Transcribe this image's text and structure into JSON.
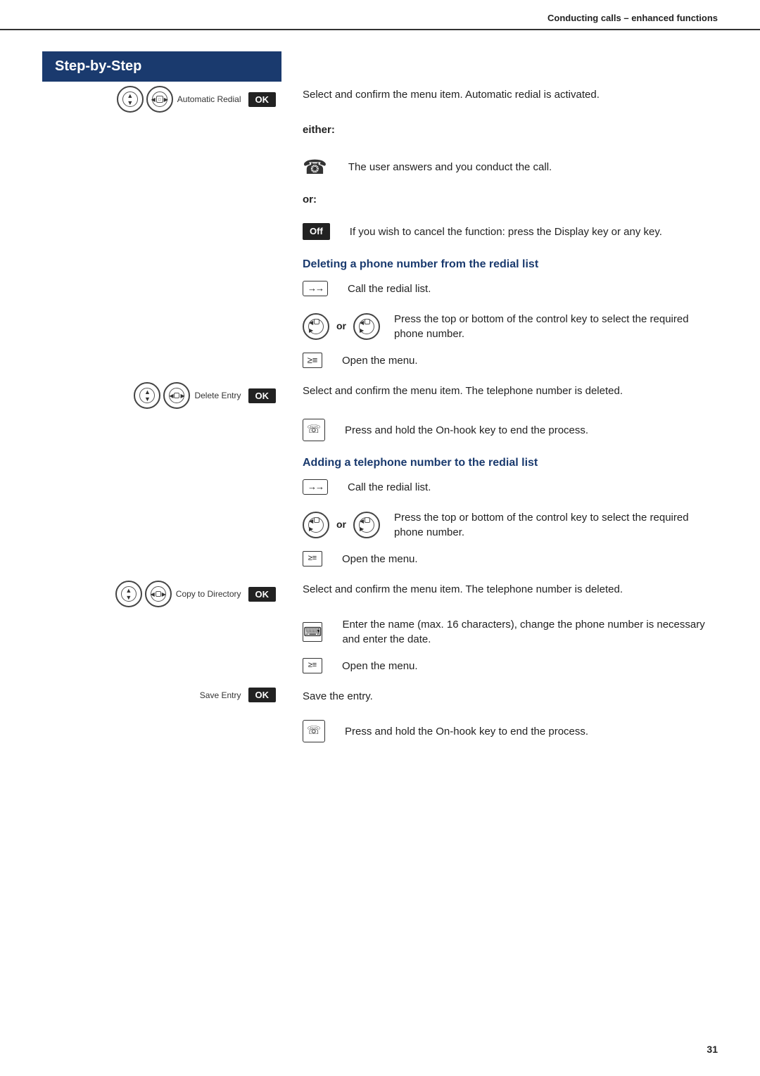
{
  "header": {
    "title": "Conducting calls – enhanced functions"
  },
  "step_by_step": "Step-by-Step",
  "rows": [
    {
      "id": "row-auto-redial",
      "left_label": "Automatic Redial",
      "left_type": "ctrl-pair-ok",
      "right_text": "Select and confirm the menu item. Automatic redial is activated."
    },
    {
      "id": "row-either",
      "left_type": "either-label",
      "left_text": "either:"
    },
    {
      "id": "row-phone",
      "left_type": "phone",
      "right_text": "The user answers and you conduct the call."
    },
    {
      "id": "row-or1",
      "left_type": "or-label",
      "left_text": "or:"
    },
    {
      "id": "row-off",
      "left_type": "off-btn",
      "right_text": "If you wish to cancel the function: press the Display key or any key."
    },
    {
      "id": "row-section1",
      "type": "section",
      "text": "Deleting a phone number from the redial list"
    },
    {
      "id": "row-arrow1",
      "left_type": "arrow",
      "right_text": "Call the redial list."
    },
    {
      "id": "row-ctrl-or1",
      "left_type": "ctrl-or-ctrl",
      "right_text": "Press the top or bottom of the control key to select the required phone number."
    },
    {
      "id": "row-menu1",
      "left_type": "menu",
      "right_text": "Open the menu."
    },
    {
      "id": "row-delete-entry",
      "left_label": "Delete Entry",
      "left_type": "ctrl-pair-ok",
      "right_text": "Select and confirm the menu item. The telephone number is deleted."
    },
    {
      "id": "row-onhook1",
      "left_type": "onhook",
      "right_text": "Press and hold the On-hook key to end the process."
    },
    {
      "id": "row-section2",
      "type": "section",
      "text": "Adding a telephone number to the redial list"
    },
    {
      "id": "row-arrow2",
      "left_type": "arrow",
      "right_text": "Call the redial list."
    },
    {
      "id": "row-ctrl-or2",
      "left_type": "ctrl-or-ctrl",
      "right_text": "Press the top or bottom of the control key to select the required phone number."
    },
    {
      "id": "row-menu2",
      "left_type": "menu",
      "right_text": "Open the menu."
    },
    {
      "id": "row-copy",
      "left_label": "Copy to Directory",
      "left_type": "ctrl-pair-ok",
      "right_text": "Select and confirm the menu item. The telephone number is deleted."
    },
    {
      "id": "row-keyboard",
      "left_type": "keyboard",
      "right_text": "Enter the name (max. 16 characters), change the phone number is necessary and enter the date."
    },
    {
      "id": "row-menu3",
      "left_type": "menu",
      "right_text": "Open the menu."
    },
    {
      "id": "row-save",
      "left_label": "Save Entry",
      "left_type": "ctrl-pair-ok",
      "right_text": "Save the entry."
    },
    {
      "id": "row-onhook2",
      "left_type": "onhook",
      "right_text": "Press and hold the On-hook key to end the process."
    }
  ],
  "page_number": "31",
  "labels": {
    "ok": "OK",
    "off": "Off",
    "either": "either:",
    "or": "or:"
  }
}
